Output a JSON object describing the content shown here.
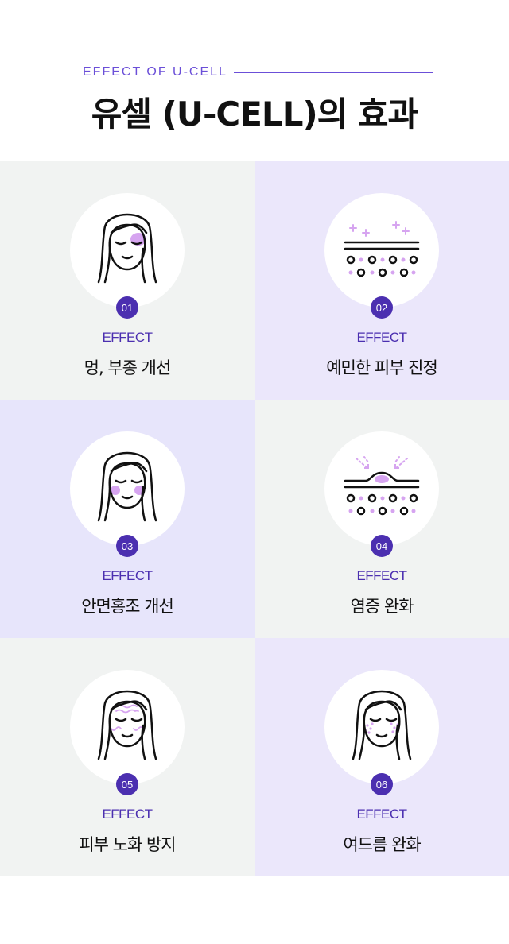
{
  "header": {
    "eyebrow": "EFFECT OF U-CELL",
    "title": "유셀 (U-CELL)의 효과"
  },
  "colors": {
    "accent": "#4b2fb0",
    "eyebrow": "#6b4fd8",
    "highlight": "#d6a4f0",
    "gray_bg": "#f1f3f2",
    "lavender_bg": "#ebe7fb"
  },
  "effects": [
    {
      "number": "01",
      "tag": "EFFECT",
      "label": "멍, 부종 개선",
      "icon": "face-eye-bruise-icon"
    },
    {
      "number": "02",
      "tag": "EFFECT",
      "label": "예민한 피부 진정",
      "icon": "skin-layer-calm-icon"
    },
    {
      "number": "03",
      "tag": "EFFECT",
      "label": "안면홍조 개선",
      "icon": "face-blush-icon"
    },
    {
      "number": "04",
      "tag": "EFFECT",
      "label": "염증 완화",
      "icon": "skin-layer-inflammation-icon"
    },
    {
      "number": "05",
      "tag": "EFFECT",
      "label": "피부 노화 방지",
      "icon": "face-wrinkle-icon"
    },
    {
      "number": "06",
      "tag": "EFFECT",
      "label": "여드름 완화",
      "icon": "face-acne-icon"
    }
  ]
}
